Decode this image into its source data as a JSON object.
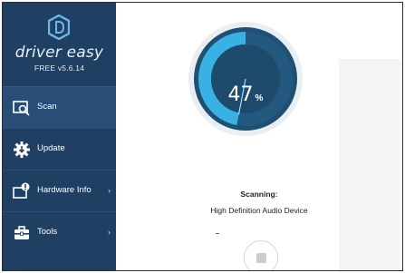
{
  "brand": {
    "name": "driver easy",
    "version": "FREE v5.6.14"
  },
  "sidebar": {
    "items": [
      {
        "label": "Scan",
        "icon": "scan-icon",
        "active": true,
        "has_chevron": false
      },
      {
        "label": "Update",
        "icon": "update-gear-icon",
        "active": false,
        "has_chevron": false
      },
      {
        "label": "Hardware Info",
        "icon": "hardware-info-icon",
        "active": false,
        "has_chevron": true
      },
      {
        "label": "Tools",
        "icon": "tools-icon",
        "active": false,
        "has_chevron": true
      }
    ],
    "chevron": "›"
  },
  "scan": {
    "progress_value": "47",
    "progress_unit": "%",
    "progress_fraction": 0.47,
    "status_title": "Scanning:",
    "current_device": "High Definition Audio Device"
  },
  "colors": {
    "sidebar_bg": "#1f3f63",
    "sidebar_active": "#284d76",
    "gauge_dark": "#1f4f73",
    "gauge_progress": "#39b1e2"
  }
}
